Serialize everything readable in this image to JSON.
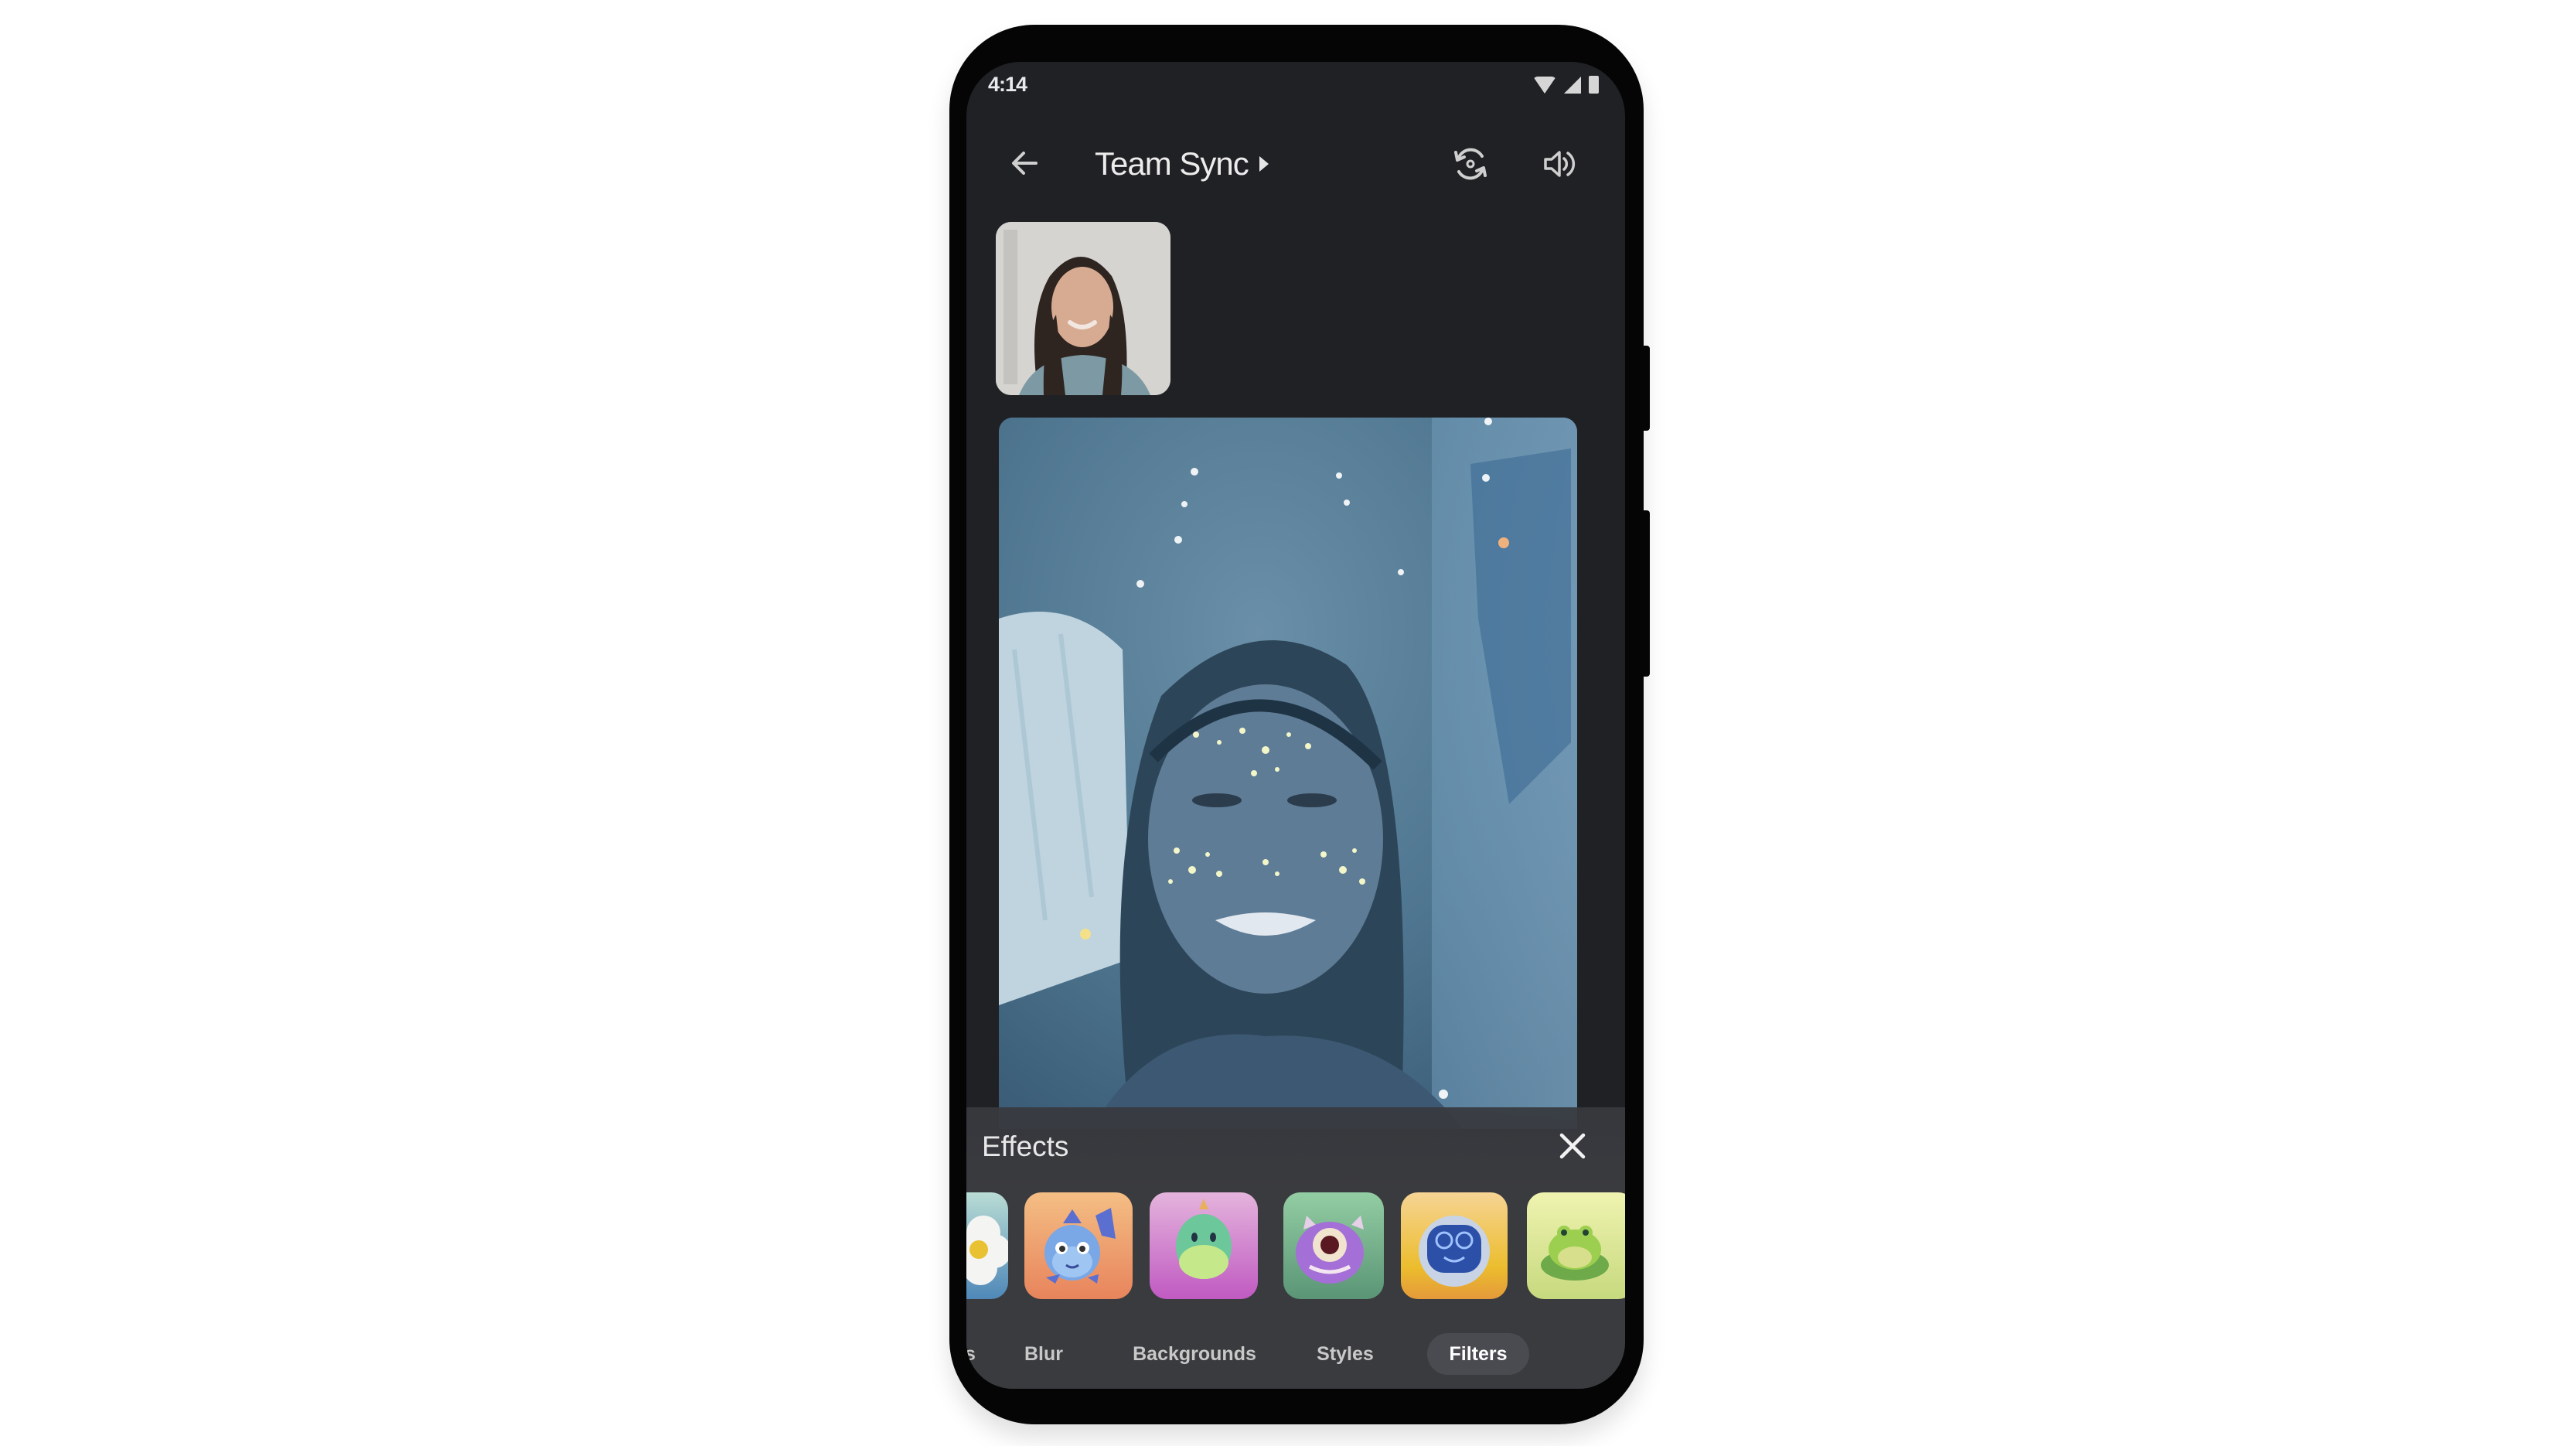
{
  "status_bar": {
    "time": "4:14",
    "icons": [
      "wifi-icon",
      "cell-signal-icon",
      "battery-icon"
    ]
  },
  "top_bar": {
    "back_icon": "arrow-left-icon",
    "title": "Team Sync",
    "title_caret_icon": "caret-right-icon",
    "actions": [
      {
        "name": "flip-camera",
        "icon": "camera-flip-icon"
      },
      {
        "name": "speaker",
        "icon": "volume-icon"
      }
    ]
  },
  "participants": {
    "self_thumbnail": "participant-video",
    "main_video": "speaker-video-with-filter"
  },
  "effects_sheet": {
    "title": "Effects",
    "close_icon": "close-icon",
    "tiles": [
      {
        "name": "flower",
        "colors": [
          "#b9dcd4",
          "#4f88b8"
        ]
      },
      {
        "name": "fish",
        "colors": [
          "#f2b27a",
          "#e98a5a"
        ]
      },
      {
        "name": "dinosaur",
        "colors": [
          "#e0a8d8",
          "#c257c4"
        ]
      },
      {
        "name": "monster",
        "colors": [
          "#8dc79e",
          "#5b9577"
        ]
      },
      {
        "name": "robot",
        "colors": [
          "#f5cf8c",
          "#ebb431"
        ]
      },
      {
        "name": "frog",
        "colors": [
          "#ecf0a8",
          "#c4d77a"
        ]
      }
    ],
    "tabs": [
      {
        "label": "s",
        "active": false
      },
      {
        "label": "Blur",
        "active": false
      },
      {
        "label": "Backgrounds",
        "active": false
      },
      {
        "label": "Styles",
        "active": false
      },
      {
        "label": "Filters",
        "active": true
      }
    ]
  }
}
